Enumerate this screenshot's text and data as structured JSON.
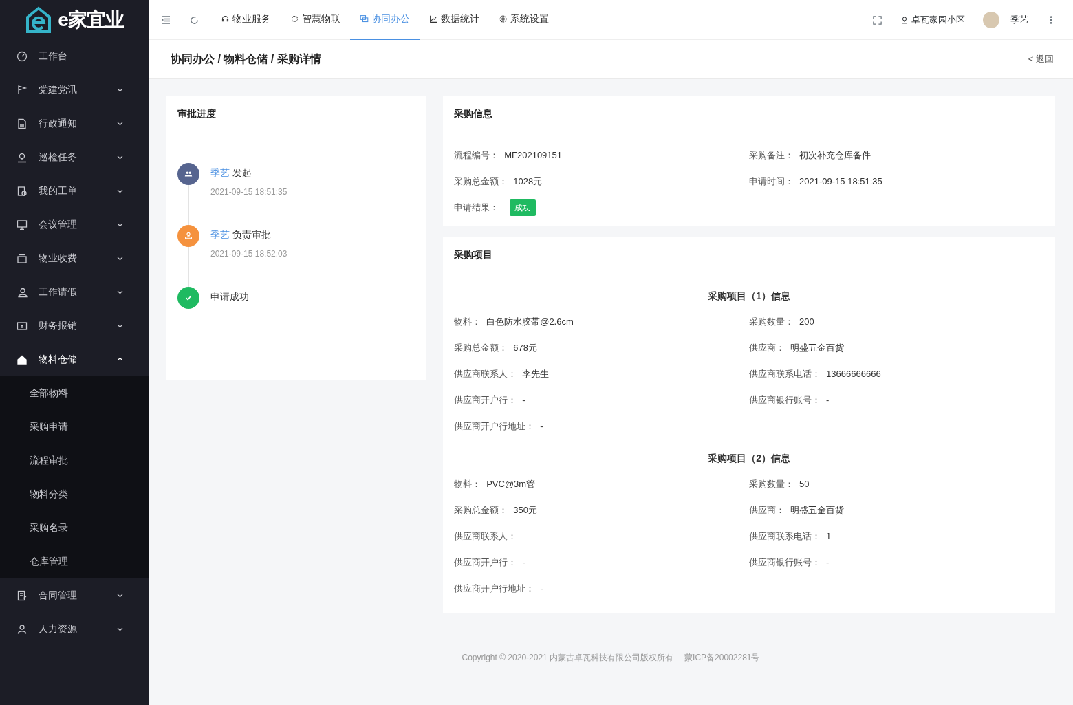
{
  "sidebar": {
    "logo_text": "e家宜业",
    "items": [
      {
        "kind": "link",
        "label": "工作台"
      },
      {
        "kind": "group",
        "label": "党建党讯",
        "expanded": false
      },
      {
        "kind": "group",
        "label": "行政通知",
        "expanded": false
      },
      {
        "kind": "group",
        "label": "巡检任务",
        "expanded": false
      },
      {
        "kind": "group",
        "label": "我的工单",
        "expanded": false
      },
      {
        "kind": "group",
        "label": "会议管理",
        "expanded": false
      },
      {
        "kind": "group",
        "label": "物业收费",
        "expanded": false
      },
      {
        "kind": "group",
        "label": "工作请假",
        "expanded": false
      },
      {
        "kind": "group",
        "label": "财务报销",
        "expanded": false
      },
      {
        "kind": "group",
        "label": "物料仓储",
        "expanded": true,
        "children": [
          {
            "label": "全部物料"
          },
          {
            "label": "采购申请"
          },
          {
            "label": "流程审批"
          },
          {
            "label": "物料分类"
          },
          {
            "label": "采购名录"
          },
          {
            "label": "仓库管理"
          }
        ]
      },
      {
        "kind": "group",
        "label": "合同管理",
        "expanded": false
      },
      {
        "kind": "group",
        "label": "人力资源",
        "expanded": false
      }
    ]
  },
  "topnav": {
    "items": [
      {
        "label": "物业服务",
        "selected": false
      },
      {
        "label": "智慧物联",
        "selected": false
      },
      {
        "label": "协同办公",
        "selected": true
      },
      {
        "label": "数据统计",
        "selected": false
      },
      {
        "label": "系统设置",
        "selected": false
      }
    ],
    "location": "卓瓦家园小区",
    "user": "季艺"
  },
  "breadcrumb": "协同办公 / 物料仓储 / 采购详情",
  "back": "< 返回",
  "approval": {
    "title": "审批进度",
    "steps": [
      {
        "kind": "start",
        "user": "季艺",
        "action": "发起",
        "time": "2021-09-15 18:51:35",
        "color": "#56648f"
      },
      {
        "kind": "approve",
        "user": "季艺",
        "action": "负责审批",
        "time": "2021-09-15 18:52:03",
        "color": "#f5923e"
      },
      {
        "kind": "done",
        "action": "申请成功",
        "color": "#1fba61"
      }
    ]
  },
  "purchase_info": {
    "title": "采购信息",
    "fields": [
      {
        "label": "流程编号：",
        "value": "MF202109151"
      },
      {
        "label": "采购备注：",
        "value": "初次补充仓库备件"
      },
      {
        "label": "采购总金额：",
        "value": "1028元"
      },
      {
        "label": "申请时间：",
        "value": "2021-09-15 18:51:35"
      }
    ],
    "result": {
      "label": "申请结果：",
      "value": "成功"
    }
  },
  "purchase_items": {
    "title": "采购项目",
    "items": [
      {
        "heading": "采购项目（1）信息",
        "fields": [
          {
            "label": "物料：",
            "value": "白色防水胶带@2.6cm"
          },
          {
            "label": "采购数量：",
            "value": "200"
          },
          {
            "label": "采购总金额：",
            "value": "678元"
          },
          {
            "label": "供应商：",
            "value": "明盛五金百货"
          },
          {
            "label": "供应商联系人：",
            "value": "李先生"
          },
          {
            "label": "供应商联系电话：",
            "value": "13666666666"
          },
          {
            "label": "供应商开户行：",
            "value": "-"
          },
          {
            "label": "供应商银行账号：",
            "value": "-"
          },
          {
            "label": "供应商开户行地址：",
            "value": "-"
          }
        ]
      },
      {
        "heading": "采购项目（2）信息",
        "fields": [
          {
            "label": "物料：",
            "value": "PVC@3m管"
          },
          {
            "label": "采购数量：",
            "value": "50"
          },
          {
            "label": "采购总金额：",
            "value": "350元"
          },
          {
            "label": "供应商：",
            "value": "明盛五金百货"
          },
          {
            "label": "供应商联系人："
          },
          {
            "label": "供应商联系电话：",
            "value": "1"
          },
          {
            "label": "供应商开户行：",
            "value": "-"
          },
          {
            "label": "供应商银行账号：",
            "value": "-"
          },
          {
            "label": "供应商开户行地址：",
            "value": "-"
          }
        ]
      }
    ]
  },
  "footer": {
    "copyright": "Copyright © 2020-2021 内蒙古卓瓦科技有限公司版权所有",
    "icp": "蒙ICP备20002281号"
  }
}
